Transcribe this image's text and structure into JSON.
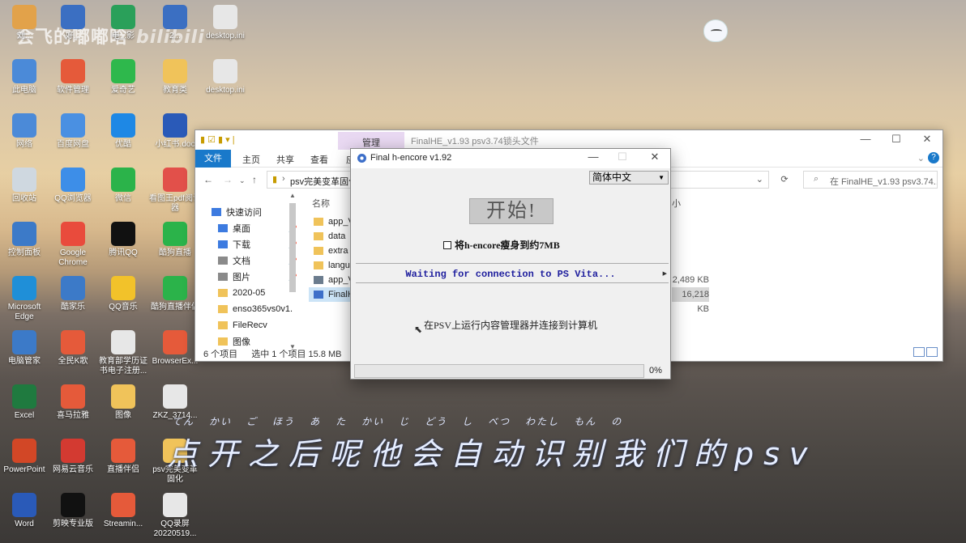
{
  "watermark": {
    "text": "会飞的嘟嘟晗",
    "logo": "bilibili"
  },
  "desktop_icons": [
    {
      "label": "刘...",
      "color": "#e2a24a"
    },
    {
      "label": "好...",
      "color": "#3b6fc2"
    },
    {
      "label": "电...影",
      "color": "#2aa05a"
    },
    {
      "label": "2...",
      "color": "#3b6fc2"
    },
    {
      "label": "desktop.ini",
      "color": "#e7e7e7"
    },
    {
      "label": "此电脑",
      "color": "#4b8ad8"
    },
    {
      "label": "软件管理",
      "color": "#e55a3a"
    },
    {
      "label": "爱奇艺",
      "color": "#2eb84c"
    },
    {
      "label": "教育类",
      "color": "#f0c35a"
    },
    {
      "label": "desktop.ini",
      "color": "#e7e7e7"
    },
    {
      "label": "网络",
      "color": "#4b8ad8"
    },
    {
      "label": "百度网盘",
      "color": "#4a90e2"
    },
    {
      "label": "优酷",
      "color": "#1e88e5"
    },
    {
      "label": "小红书.doc",
      "color": "#2a5ab8"
    },
    {
      "label": "回收站",
      "color": "#cfd8e0"
    },
    {
      "label": "QQ浏览器",
      "color": "#3d8ee8"
    },
    {
      "label": "微信",
      "color": "#2bb34a"
    },
    {
      "label": "看图王pdf阅读器",
      "color": "#e2504a"
    },
    {
      "label": "控制面板",
      "color": "#3c7ac8"
    },
    {
      "label": "Google Chrome",
      "color": "#e94b3c"
    },
    {
      "label": "腾讯QQ",
      "color": "#111111"
    },
    {
      "label": "酷狗直播",
      "color": "#2bb34a"
    },
    {
      "label": "Microsoft Edge",
      "color": "#1f8fd8"
    },
    {
      "label": "酷家乐",
      "color": "#3c7ac8"
    },
    {
      "label": "QQ音乐",
      "color": "#f2c22a"
    },
    {
      "label": "酷狗直播伴侣",
      "color": "#2bb34a"
    },
    {
      "label": "电脑管家",
      "color": "#3c7ac8"
    },
    {
      "label": "全民K歌",
      "color": "#e55a3a"
    },
    {
      "label": "教育部学历证书电子注册...",
      "color": "#e7e7e7"
    },
    {
      "label": "BrowserEx...",
      "color": "#e55a3a"
    },
    {
      "label": "Excel",
      "color": "#1f7a3f"
    },
    {
      "label": "喜马拉雅",
      "color": "#e55a3a"
    },
    {
      "label": "图像",
      "color": "#f0c35a"
    },
    {
      "label": "ZKZ_3714...",
      "color": "#e7e7e7"
    },
    {
      "label": "PowerPoint",
      "color": "#d24726"
    },
    {
      "label": "网易云音乐",
      "color": "#d33a31"
    },
    {
      "label": "直播伴侣",
      "color": "#e55a3a"
    },
    {
      "label": "psv完美变革固化",
      "color": "#f0c35a"
    },
    {
      "label": "Word",
      "color": "#2a5ab8"
    },
    {
      "label": "剪映专业版",
      "color": "#111111"
    },
    {
      "label": "Streamin...",
      "color": "#e55a3a"
    },
    {
      "label": "QQ录屏20220519...",
      "color": "#e7e7e7"
    }
  ],
  "explorer": {
    "title": "FinalHE_v1.93 psv3.74锁头文件",
    "manage_tab": "管理",
    "ribbon_tabs": [
      "文件",
      "主页",
      "共享",
      "查看",
      "应"
    ],
    "window_controls": [
      "—",
      "☐",
      "✕"
    ],
    "help": "?",
    "path": "psv完美变革固化",
    "search_placeholder": "在 FinalHE_v1.93 psv3.74...",
    "nav_items": [
      {
        "label": "快速访问",
        "pinned": false,
        "color": "#3d7be0"
      },
      {
        "label": "桌面",
        "pinned": true,
        "color": "#3d7be0"
      },
      {
        "label": "下载",
        "pinned": true,
        "color": "#3d7be0"
      },
      {
        "label": "文档",
        "pinned": true,
        "color": "#8a8a8a"
      },
      {
        "label": "图片",
        "pinned": true,
        "color": "#8a8a8a"
      },
      {
        "label": "2020-05",
        "pinned": false,
        "color": "#f0c35a"
      },
      {
        "label": "enso365vs0v1.",
        "pinned": false,
        "color": "#f0c35a"
      },
      {
        "label": "FileRecv",
        "pinned": false,
        "color": "#f0c35a"
      },
      {
        "label": "图像",
        "pinned": false,
        "color": "#f0c35a"
      }
    ],
    "column_name": "名称",
    "column_size": "小",
    "files": [
      {
        "name": "app_V",
        "color": "#f0c35a",
        "size": "",
        "selected": false
      },
      {
        "name": "data",
        "color": "#f0c35a",
        "size": "",
        "selected": false
      },
      {
        "name": "extra",
        "color": "#f0c35a",
        "size": "",
        "selected": false
      },
      {
        "name": "langua",
        "color": "#f0c35a",
        "size": "",
        "selected": false
      },
      {
        "name": "app_V",
        "color": "#6b7c8e",
        "size": "2,489 KB",
        "selected": false
      },
      {
        "name": "FinalH",
        "color": "#3d6fc9",
        "size": "16,218 KB",
        "selected": true
      }
    ],
    "status": {
      "count": "6 个项目",
      "selected": "选中 1 个项目  15.8 MB"
    }
  },
  "hencore": {
    "title": "Final h-encore v1.92",
    "controls": {
      "minimize": "—",
      "maximize": "☐",
      "close": "✕"
    },
    "language": "简体中文",
    "start_label": "开始!",
    "shrink_label": "将h-encore瘦身到约7MB",
    "status": "Waiting for connection to PS Vita...",
    "instruction": "在PSV上运行内容管理器并连接到计算机",
    "progress_fraction": 0,
    "progress_text": "0%"
  },
  "subtitle": {
    "ruby": [
      "てん",
      "かい",
      "ご",
      "ほう",
      "あ",
      "た",
      "かい",
      "じ",
      "どう",
      "し",
      "べつ",
      "わたし",
      "もん",
      "の"
    ],
    "text": "点开之后呢他会自动识别我们的psv"
  }
}
